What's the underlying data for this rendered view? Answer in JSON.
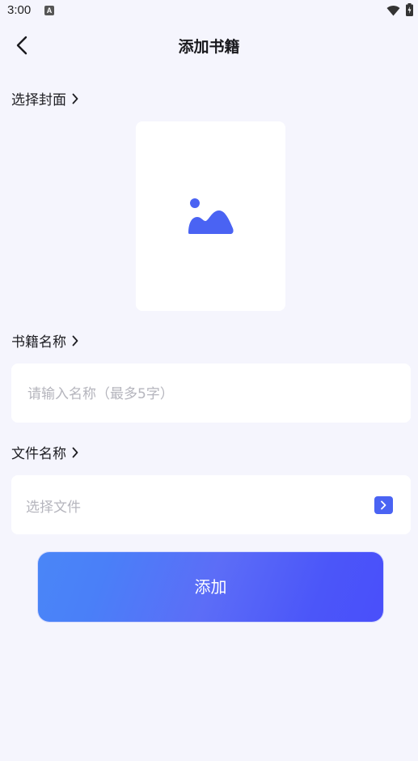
{
  "status_bar": {
    "time": "3:00",
    "notification_badge": "A"
  },
  "header": {
    "title": "添加书籍"
  },
  "cover_section": {
    "label": "选择封面"
  },
  "name_section": {
    "label": "书籍名称",
    "placeholder": "请输入名称（最多5字）",
    "value": ""
  },
  "file_section": {
    "label": "文件名称",
    "placeholder": "选择文件"
  },
  "submit": {
    "label": "添加"
  },
  "colors": {
    "background": "#f5f5fd",
    "accent": "#4a63f3",
    "button_gradient_start": "#4a86f7",
    "button_gradient_end": "#4a4ffa"
  },
  "icons": {
    "back": "chevron-left-icon",
    "cover": "image-icon",
    "file_action": "chevron-right-icon"
  }
}
